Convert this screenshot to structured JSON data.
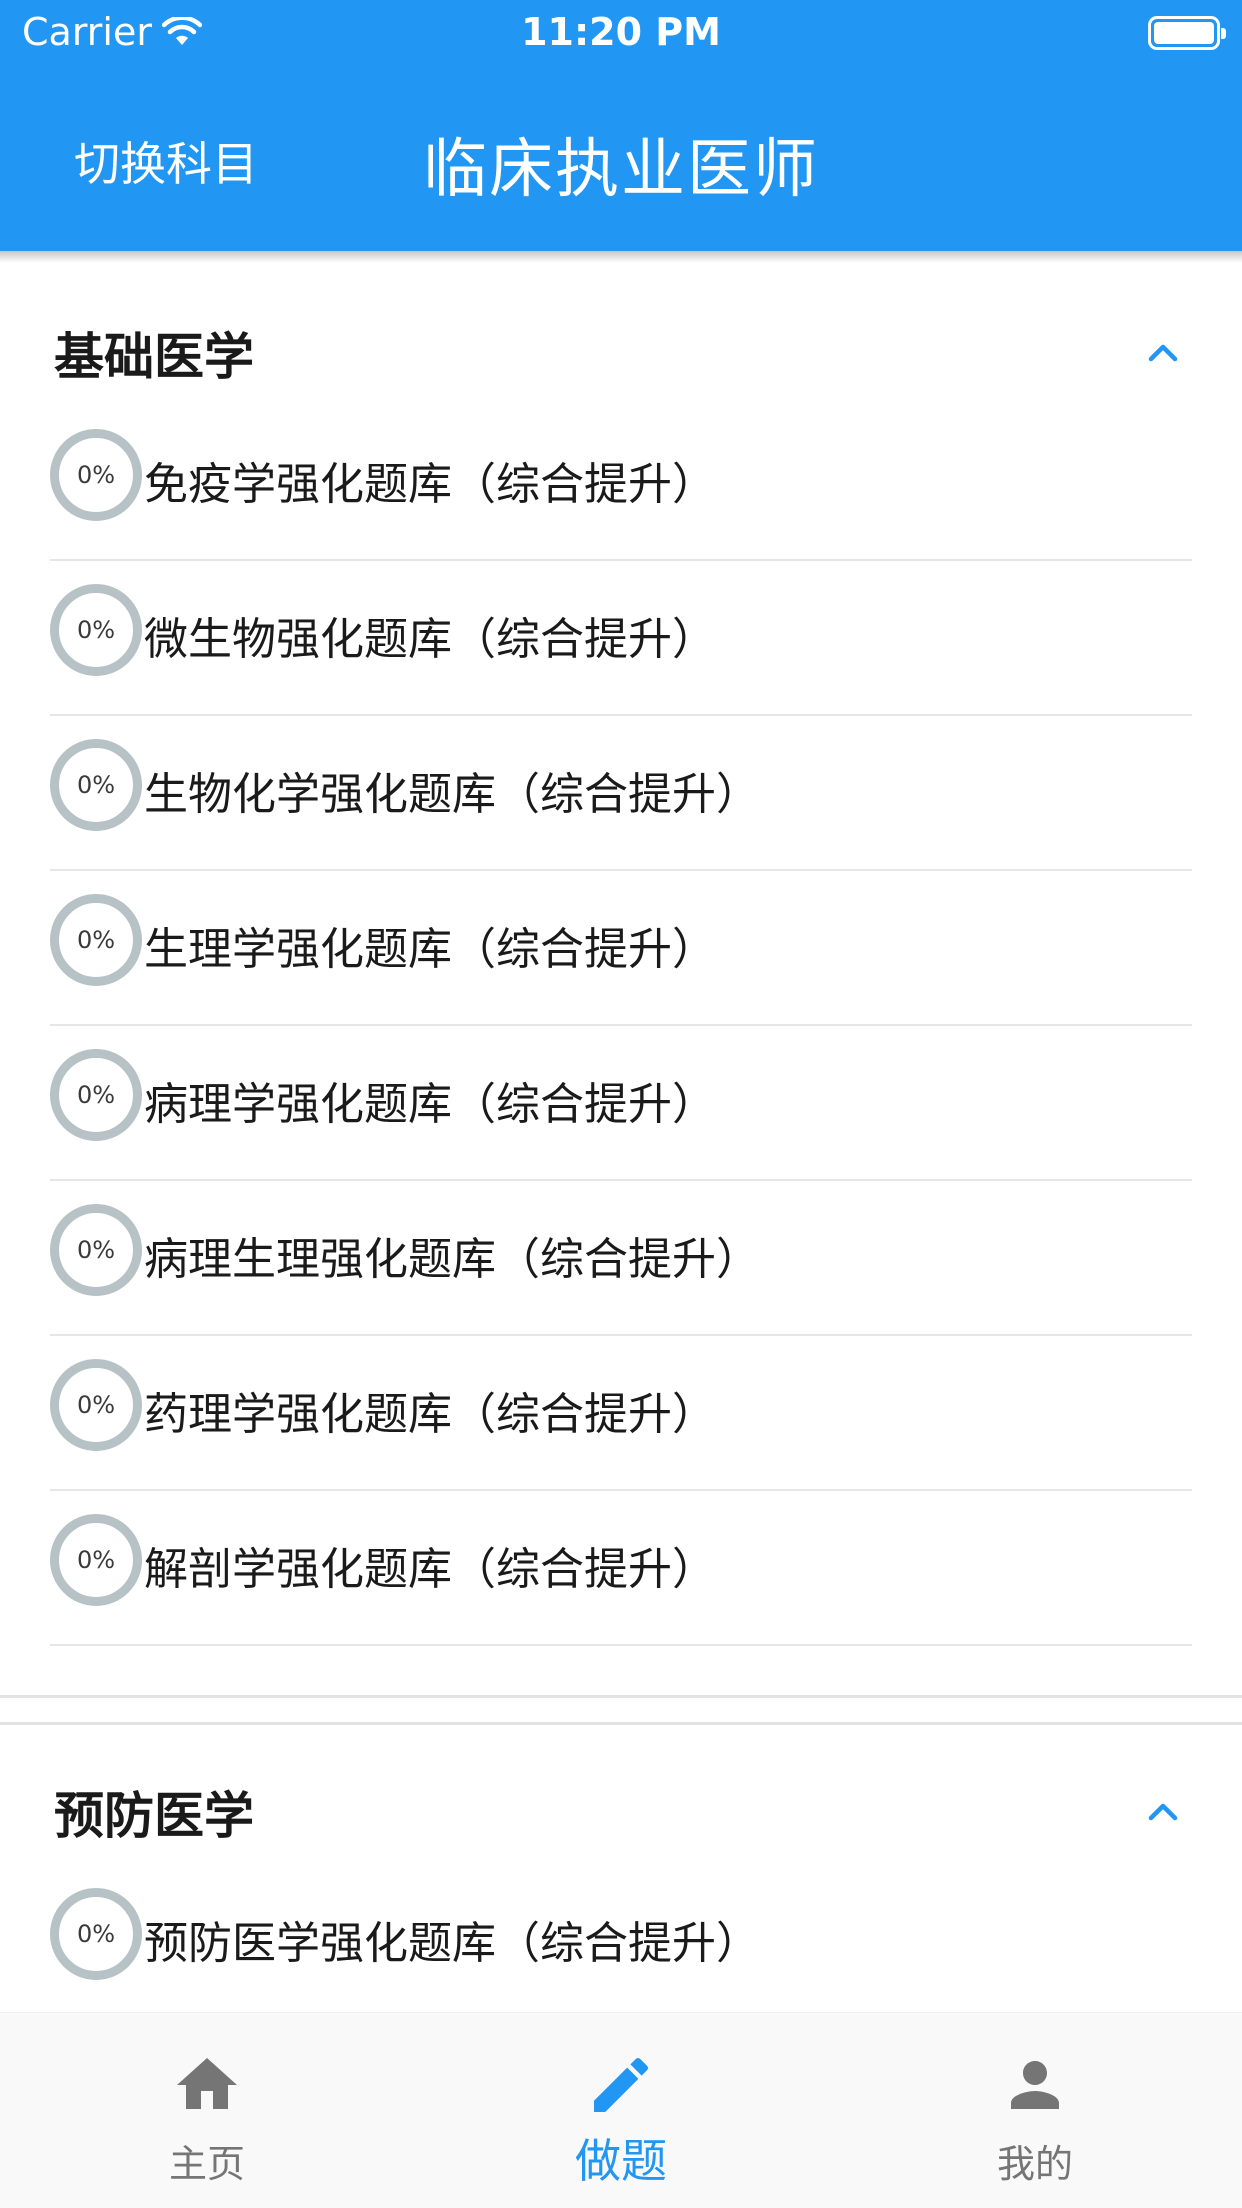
{
  "status_bar": {
    "carrier": "Carrier",
    "time": "11:20 PM"
  },
  "header": {
    "switch_label": "切换科目",
    "title": "临床执业医师"
  },
  "sections": [
    {
      "title": "基础医学",
      "items": [
        {
          "progress": "0%",
          "label": "免疫学强化题库（综合提升）"
        },
        {
          "progress": "0%",
          "label": "微生物强化题库（综合提升）"
        },
        {
          "progress": "0%",
          "label": "生物化学强化题库（综合提升）"
        },
        {
          "progress": "0%",
          "label": "生理学强化题库（综合提升）"
        },
        {
          "progress": "0%",
          "label": "病理学强化题库（综合提升）"
        },
        {
          "progress": "0%",
          "label": "病理生理强化题库（综合提升）"
        },
        {
          "progress": "0%",
          "label": "药理学强化题库（综合提升）"
        },
        {
          "progress": "0%",
          "label": "解剖学强化题库（综合提升）"
        }
      ]
    },
    {
      "title": "预防医学",
      "items": [
        {
          "progress": "0%",
          "label": "预防医学强化题库（综合提升）"
        }
      ]
    }
  ],
  "bottom_nav": [
    {
      "label": "主页",
      "icon": "home-icon",
      "active": false
    },
    {
      "label": "做题",
      "icon": "pencil-icon",
      "active": true
    },
    {
      "label": "我的",
      "icon": "person-icon",
      "active": false
    }
  ],
  "colors": {
    "primary": "#2196f3",
    "ring": "#b7c2c6",
    "inactive_nav": "#757575"
  }
}
